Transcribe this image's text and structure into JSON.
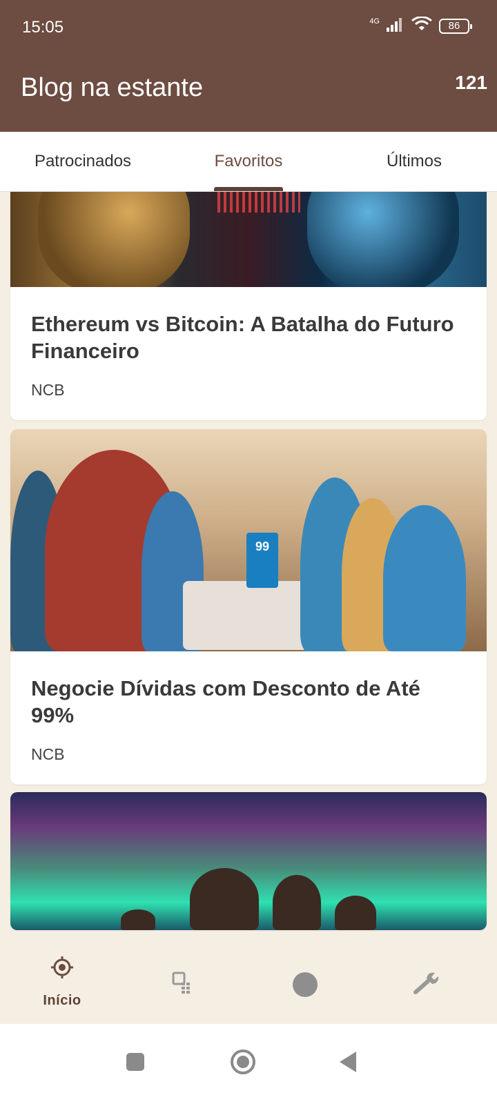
{
  "status_bar": {
    "time": "15:05",
    "network": "4G",
    "battery": "86"
  },
  "app_bar": {
    "title": "Blog na estante",
    "count": "121"
  },
  "tabs": [
    {
      "label": "Patrocinados",
      "active": false
    },
    {
      "label": "Favoritos",
      "active": true
    },
    {
      "label": "Últimos",
      "active": false
    }
  ],
  "feed": {
    "cards": [
      {
        "title": "Ethereum vs Bitcoin: A Batalha do Futuro Financeiro",
        "source": "NCB"
      },
      {
        "title": "Negocie Dívidas com Desconto de Até 99%",
        "source": "NCB"
      },
      {
        "title": "",
        "source": ""
      }
    ],
    "card2_image_sign": "99"
  },
  "bottom_nav": {
    "items": [
      {
        "label": "Início",
        "icon": "target-icon",
        "active": true
      },
      {
        "label": "",
        "icon": "calendar-grid-icon",
        "active": false
      },
      {
        "label": "",
        "icon": "circle-icon",
        "active": false
      },
      {
        "label": "",
        "icon": "wrench-icon",
        "active": false
      }
    ]
  },
  "colors": {
    "primary": "#6d4c41",
    "background": "#f5efe3",
    "card": "#ffffff"
  }
}
